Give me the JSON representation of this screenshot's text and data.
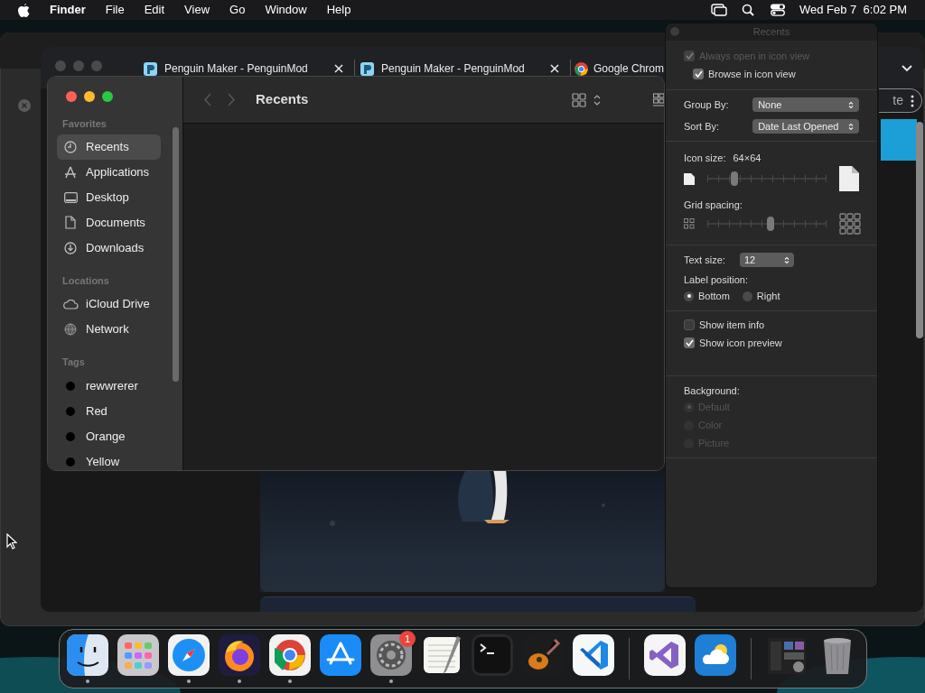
{
  "menu_bar": {
    "app": "Finder",
    "menus": [
      "File",
      "Edit",
      "View",
      "Go",
      "Window",
      "Help"
    ],
    "clock": "Wed Feb 7  6:02 PM"
  },
  "browser": {
    "tabs": [
      {
        "label": "Penguin Maker - PenguinMod",
        "kind": "penguinmod"
      },
      {
        "label": "Penguin Maker - PenguinMod",
        "kind": "penguinmod"
      },
      {
        "label": "Google Chrom",
        "kind": "chrome"
      }
    ],
    "button": "te"
  },
  "finder": {
    "title": "Recents",
    "sidebar": {
      "sections": [
        {
          "heading": "Favorites",
          "items": [
            {
              "label": "Recents",
              "kind": "clock",
              "selected": true
            },
            {
              "label": "Applications",
              "kind": "apps",
              "selected": false
            },
            {
              "label": "Desktop",
              "kind": "desktop",
              "selected": false
            },
            {
              "label": "Documents",
              "kind": "document",
              "selected": false
            },
            {
              "label": "Downloads",
              "kind": "download",
              "selected": false
            }
          ]
        },
        {
          "heading": "Locations",
          "items": [
            {
              "label": "iCloud Drive",
              "kind": "cloud",
              "selected": false
            },
            {
              "label": "Network",
              "kind": "globe",
              "selected": false
            }
          ]
        },
        {
          "heading": "Tags",
          "items": [
            {
              "label": "rewwrerer",
              "kind": "tag",
              "selected": false
            },
            {
              "label": "Red",
              "kind": "tag",
              "selected": false
            },
            {
              "label": "Orange",
              "kind": "tag",
              "selected": false
            },
            {
              "label": "Yellow",
              "kind": "tag",
              "selected": false
            }
          ]
        }
      ]
    }
  },
  "view_options": {
    "title": "Recents",
    "checks_top": [
      {
        "label": "Always open in icon view",
        "checked": true,
        "disabled": true,
        "children": [
          {
            "label": "Browse in icon view",
            "checked": true,
            "disabled": false
          }
        ]
      }
    ],
    "group_by": {
      "label": "Group By:",
      "value": "None"
    },
    "sort_by": {
      "label": "Sort By:",
      "value": "Date Last Opened"
    },
    "icon_size": {
      "label": "Icon size:",
      "value": "64×64",
      "level": 0.23
    },
    "grid_spacing": {
      "label": "Grid spacing:",
      "level": 0.53
    },
    "text_size": {
      "label": "Text size:",
      "value": "12"
    },
    "label_position": {
      "label": "Label position:",
      "options": [
        {
          "label": "Bottom",
          "selected": true
        },
        {
          "label": "Right",
          "selected": false
        }
      ]
    },
    "checks": [
      {
        "label": "Show item info",
        "checked": false
      },
      {
        "label": "Show icon preview",
        "checked": true
      }
    ],
    "background": {
      "label": "Background:",
      "disabled": true,
      "options": [
        {
          "label": "Default",
          "selected": true
        },
        {
          "label": "Color",
          "selected": false
        },
        {
          "label": "Picture",
          "selected": false
        }
      ]
    }
  },
  "dock": {
    "apps": [
      {
        "kind": "finder",
        "running": true
      },
      {
        "kind": "launchpad",
        "running": false
      },
      {
        "kind": "safari",
        "running": true
      },
      {
        "kind": "firefox",
        "running": true
      },
      {
        "kind": "chrome",
        "running": true
      },
      {
        "kind": "appstore",
        "running": false
      },
      {
        "kind": "settings",
        "running": true,
        "badge": "1"
      },
      {
        "kind": "textedit",
        "running": false
      },
      {
        "kind": "terminal",
        "running": false
      },
      {
        "kind": "guitar",
        "running": false
      },
      {
        "kind": "vscode",
        "running": false
      },
      {
        "kind": "separator"
      },
      {
        "kind": "visualstudio",
        "running": false
      },
      {
        "kind": "weather",
        "running": false
      },
      {
        "kind": "separator"
      },
      {
        "kind": "thumbnail",
        "running": false
      },
      {
        "kind": "trash",
        "running": false
      }
    ]
  }
}
